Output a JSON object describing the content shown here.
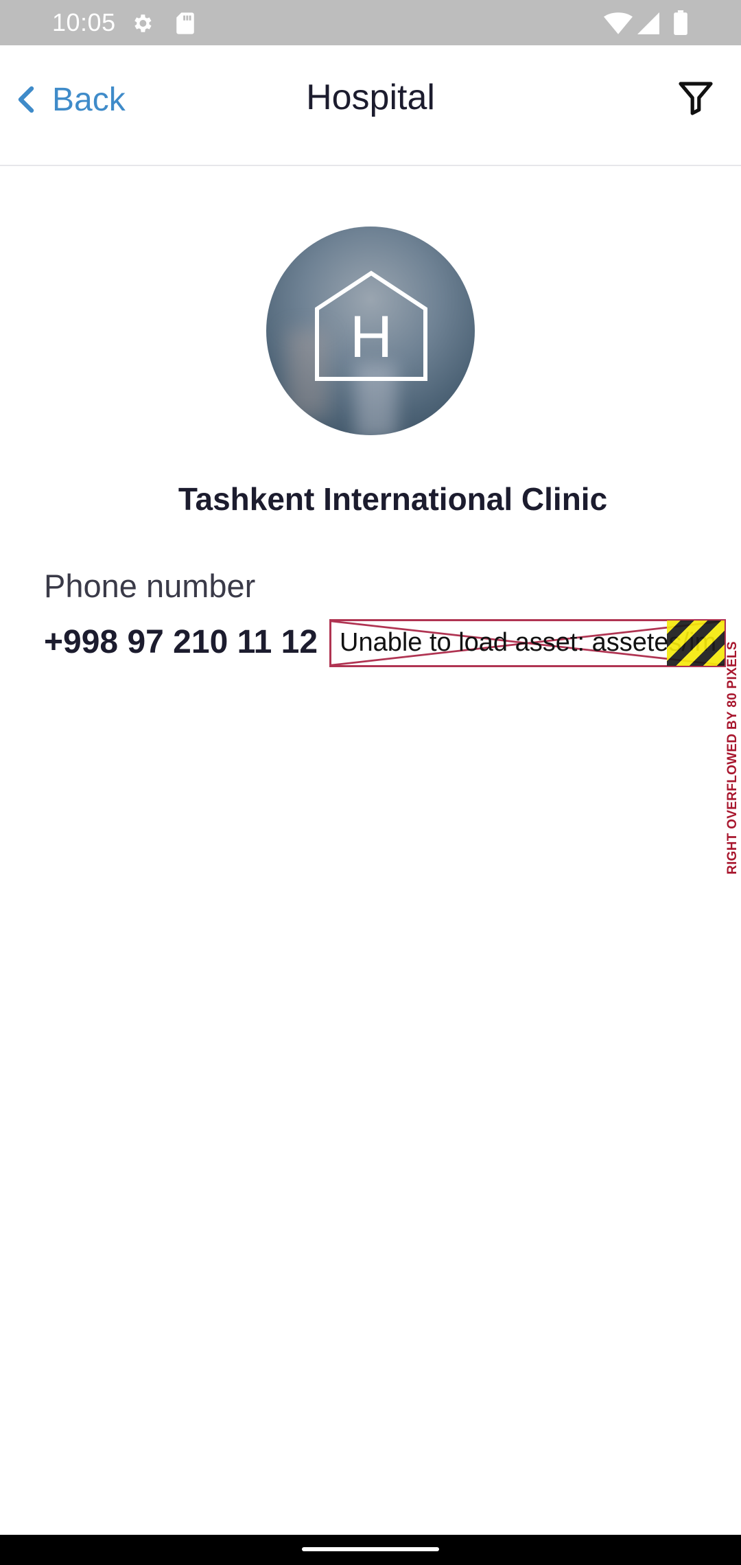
{
  "status_bar": {
    "time": "10:05",
    "icons": [
      "gear-icon",
      "sd-card-icon",
      "wifi-icon",
      "signal-icon",
      "battery-icon"
    ],
    "background": "#bdbdbd"
  },
  "app_bar": {
    "back_label": "Back",
    "title": "Hospital",
    "filter_icon": "filter-icon",
    "accent_color": "#3f8bc9"
  },
  "hospital": {
    "avatar_icon": "hospital-icon",
    "avatar_letter": "H",
    "name": "Tashkent International Clinic",
    "phone_label": "Phone number",
    "phone_value": "+998 97 210 11 12"
  },
  "error_overlay": {
    "asset_message": "Unable to load asset: assetes/im",
    "overflow_message": "RIGHT OVERFLOWED BY 80 PIXELS",
    "error_color": "#b03452"
  }
}
